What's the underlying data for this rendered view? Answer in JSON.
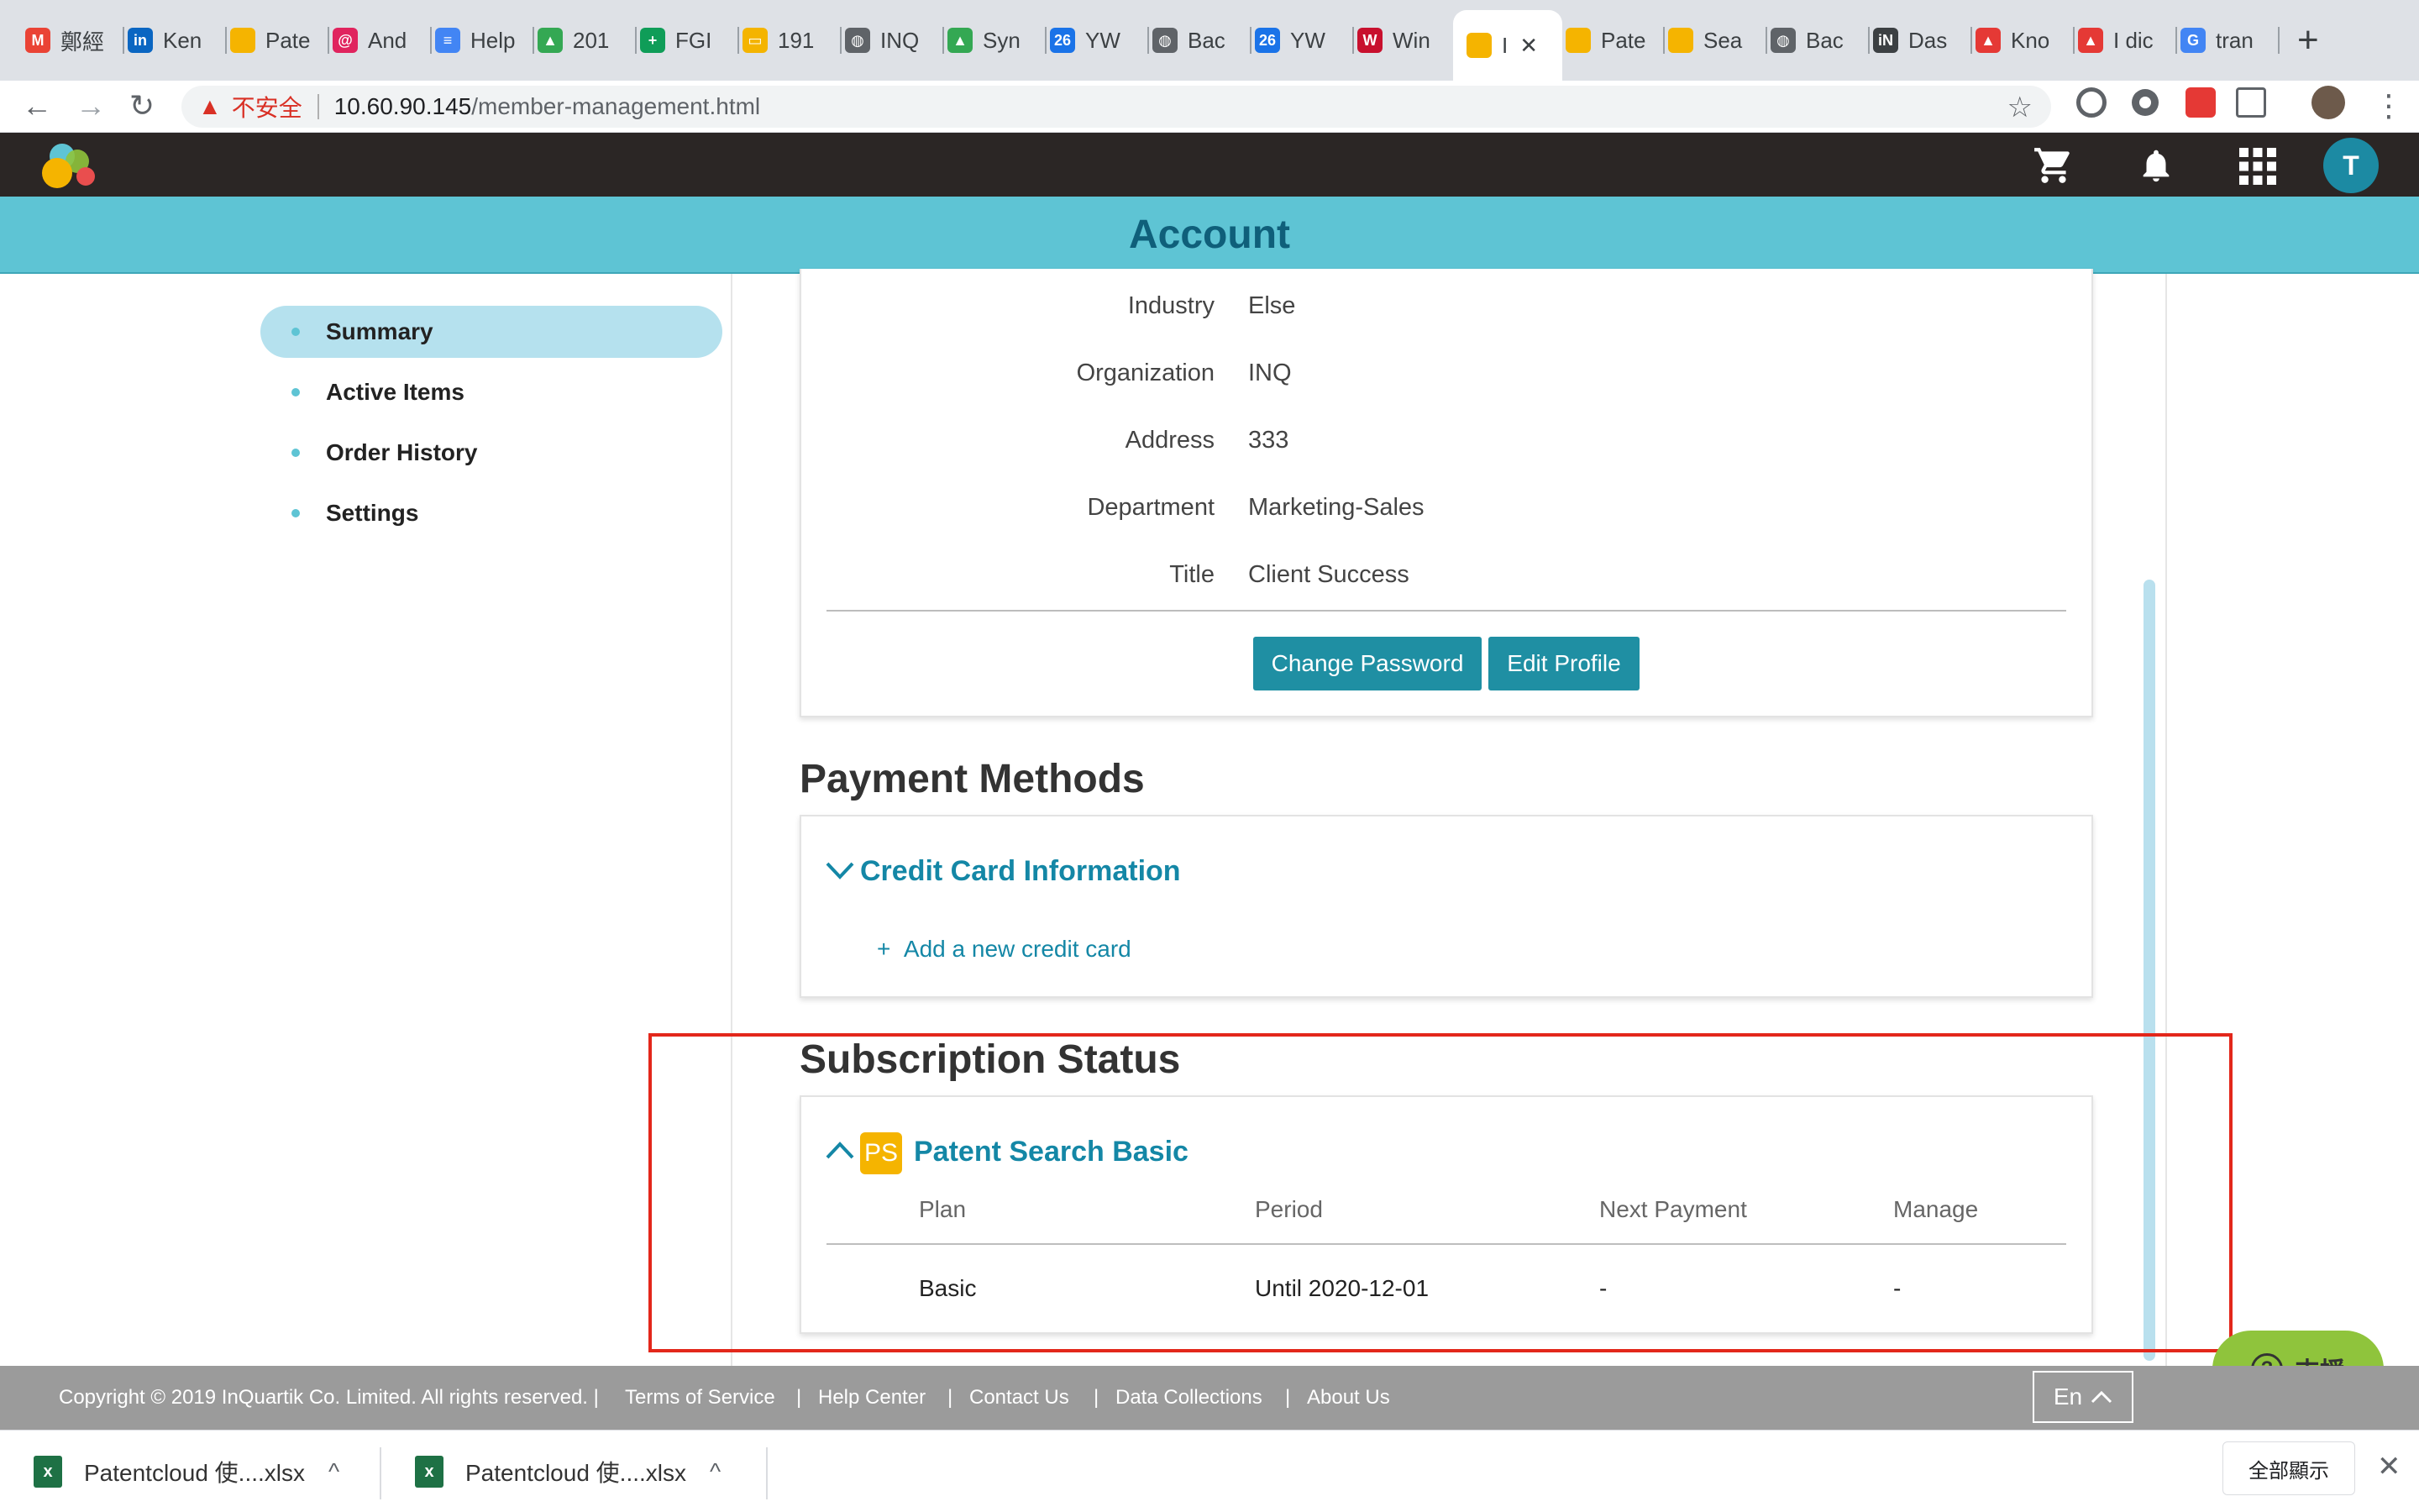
{
  "browser": {
    "tabs": [
      {
        "label": "鄭經",
        "icon": "gmail-icon",
        "color": "#ea4335",
        "glyph": "M"
      },
      {
        "label": "Ken",
        "icon": "linkedin-icon",
        "color": "#0a66c2",
        "glyph": "in"
      },
      {
        "label": "Pate",
        "icon": "patentcloud-icon",
        "color": "#f5b400",
        "glyph": ""
      },
      {
        "label": "And",
        "icon": "pin-icon",
        "color": "#e0245e",
        "glyph": "@"
      },
      {
        "label": "Help",
        "icon": "docs-icon",
        "color": "#4285f4",
        "glyph": "≡"
      },
      {
        "label": "201",
        "icon": "drive-icon",
        "color": "#34a853",
        "glyph": "▲"
      },
      {
        "label": "FGI",
        "icon": "sheets-icon",
        "color": "#0f9d58",
        "glyph": "+"
      },
      {
        "label": "191",
        "icon": "slides-icon",
        "color": "#f4b400",
        "glyph": "▭"
      },
      {
        "label": "INQ",
        "icon": "globe-icon",
        "color": "#5f6368",
        "glyph": "◍"
      },
      {
        "label": "Syn",
        "icon": "drive-icon",
        "color": "#34a853",
        "glyph": "▲"
      },
      {
        "label": "YW",
        "icon": "calendar-icon",
        "color": "#1a73e8",
        "glyph": "26"
      },
      {
        "label": "Bac",
        "icon": "globe-icon",
        "color": "#5f6368",
        "glyph": "◍"
      },
      {
        "label": "YW",
        "icon": "calendar-icon",
        "color": "#1a73e8",
        "glyph": "26"
      },
      {
        "label": "Win",
        "icon": "w-icon",
        "color": "#c8102e",
        "glyph": "W"
      },
      {
        "label": "I",
        "icon": "patentcloud-icon",
        "color": "#f5b400",
        "glyph": ""
      },
      {
        "label": "Pate",
        "icon": "patentcloud-icon",
        "color": "#f5b400",
        "glyph": ""
      },
      {
        "label": "Sea",
        "icon": "patentcloud-icon",
        "color": "#f5b400",
        "glyph": ""
      },
      {
        "label": "Bac",
        "icon": "globe-icon",
        "color": "#5f6368",
        "glyph": "◍"
      },
      {
        "label": "Das",
        "icon": "in-circle-icon",
        "color": "#3c4043",
        "glyph": "iN"
      },
      {
        "label": "Kno",
        "icon": "triangle-icon",
        "color": "#e53935",
        "glyph": "▲"
      },
      {
        "label": "I dic",
        "icon": "triangle-icon",
        "color": "#e53935",
        "glyph": "▲"
      },
      {
        "label": "tran",
        "icon": "google-icon",
        "color": "#4285f4",
        "glyph": "G"
      }
    ],
    "active_tab_index": 14,
    "insecure_label": "不安全",
    "url_host": "10.60.90.145",
    "url_path": "/member-management.html"
  },
  "header": {
    "page_title": "Account",
    "avatar_initial": "T"
  },
  "sidebar": {
    "items": [
      {
        "label": "Summary",
        "active": true
      },
      {
        "label": "Active Items",
        "active": false
      },
      {
        "label": "Order History",
        "active": false
      },
      {
        "label": "Settings",
        "active": false
      }
    ]
  },
  "profile": {
    "fields": [
      {
        "label": "Industry",
        "value": "Else"
      },
      {
        "label": "Organization",
        "value": "INQ"
      },
      {
        "label": "Address",
        "value": "333"
      },
      {
        "label": "Department",
        "value": "Marketing-Sales"
      },
      {
        "label": "Title",
        "value": "Client Success"
      }
    ],
    "change_password_label": "Change Password",
    "edit_profile_label": "Edit Profile"
  },
  "payment": {
    "heading": "Payment Methods",
    "accordion_title": "Credit Card Information",
    "add_card_label": "Add a new credit card"
  },
  "subscription": {
    "heading": "Subscription Status",
    "product_badge": "PS",
    "product_name": "Patent Search Basic",
    "columns": [
      "Plan",
      "Period",
      "Next Payment",
      "Manage"
    ],
    "rows": [
      [
        "Basic",
        "Until 2020-12-01",
        "-",
        "-"
      ]
    ]
  },
  "support": {
    "label": "支援"
  },
  "footer": {
    "copyright": "Copyright © 2019 InQuartik Co. Limited. All rights reserved. |",
    "links": [
      "Terms of Service",
      "Help Center",
      "Contact Us",
      "Data Collections",
      "About Us"
    ],
    "language": "En"
  },
  "downloads": {
    "items": [
      {
        "filename": "Patentcloud 使....xlsx"
      },
      {
        "filename": "Patentcloud 使....xlsx"
      }
    ],
    "show_all_label": "全部顯示"
  },
  "colors": {
    "accent": "#5ec4d4",
    "primary_button": "#1f8fa3",
    "link": "#1487a6",
    "highlight_box": "#e3271b",
    "support_button": "#8fc43c",
    "app_header": "#2b2625"
  }
}
